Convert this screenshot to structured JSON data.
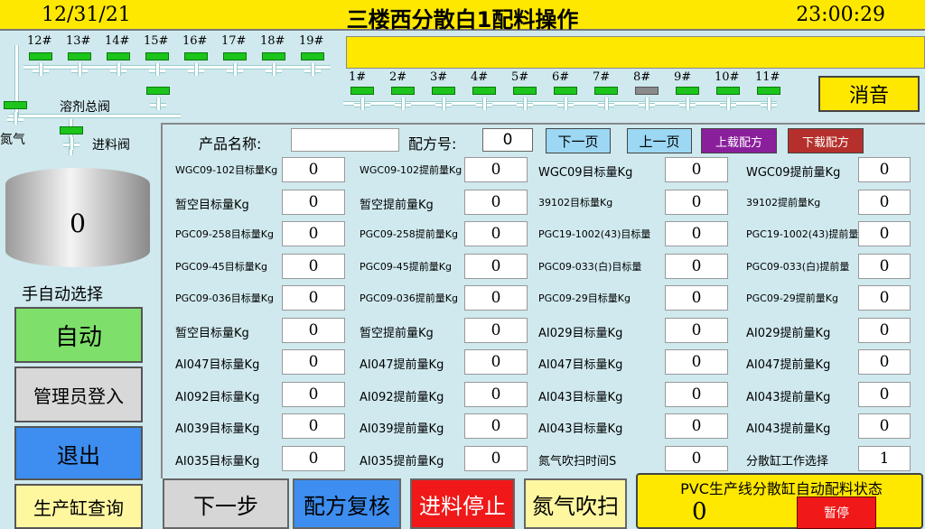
{
  "header": {
    "date": "12/31/21",
    "title": "三楼西分散白1配料操作",
    "time": "23:00:29"
  },
  "solvent_valves": {
    "labels": [
      "12#",
      "13#",
      "14#",
      "15#",
      "16#",
      "17#",
      "18#",
      "19#"
    ],
    "states": [
      "on",
      "on",
      "on",
      "on",
      "on",
      "on",
      "on",
      "on"
    ]
  },
  "solvent_label": "溶剂总阀",
  "nitrogen_label": "氮气",
  "feed_valve_label": "进料阀",
  "feed_valves": {
    "labels": [
      "1#",
      "2#",
      "3#",
      "4#",
      "5#",
      "6#",
      "7#",
      "8#",
      "9#",
      "10#",
      "11#"
    ],
    "states": [
      "on",
      "on",
      "on",
      "on",
      "on",
      "on",
      "on",
      "off",
      "on",
      "on",
      "on"
    ]
  },
  "mute_button": "消音",
  "tank": {
    "value": "0"
  },
  "left_panel": {
    "mode_title": "手自动选择",
    "auto_button": "自动",
    "admin_button": "管理员登入",
    "exit_button": "退出",
    "query_button": "生产缸查询"
  },
  "form": {
    "product_name_label": "产品名称:",
    "product_name_value": "",
    "recipe_no_label": "配方号:",
    "recipe_no_value": "0",
    "next_page": "下一页",
    "prev_page": "上一页",
    "upload_recipe": "上载配方",
    "download_recipe": "下载配方"
  },
  "fields": [
    [
      "WGC09-102目标量Kg",
      "0",
      "WGC09-102提前量Kg",
      "0",
      "WGC09目标量Kg",
      "0",
      "WGC09提前量Kg",
      "0"
    ],
    [
      "暂空目标量Kg",
      "0",
      "暂空提前量Kg",
      "0",
      "39102目标量Kg",
      "0",
      "39102提前量Kg",
      "0"
    ],
    [
      "PGC09-258目标量Kg",
      "0",
      "PGC09-258提前量Kg",
      "0",
      "PGC19-1002(43)目标量",
      "0",
      "PGC19-1002(43)提前量",
      "0"
    ],
    [
      "PGC09-45目标量Kg",
      "0",
      "PGC09-45提前量Kg",
      "0",
      "PGC09-033(白)目标量",
      "0",
      "PGC09-033(白)提前量",
      "0"
    ],
    [
      "PGC09-036目标量Kg",
      "0",
      "PGC09-036提前量Kg",
      "0",
      "PGC09-29目标量Kg",
      "0",
      "PGC09-29提前量Kg",
      "0"
    ],
    [
      "暂空目标量Kg",
      "0",
      "暂空提前量Kg",
      "0",
      "AI029目标量Kg",
      "0",
      "AI029提前量Kg",
      "0"
    ],
    [
      "AI047目标量Kg",
      "0",
      "AI047提前量Kg",
      "0",
      "AI047目标量Kg",
      "0",
      "AI047提前量Kg",
      "0"
    ],
    [
      "AI092目标量Kg",
      "0",
      "AI092提前量Kg",
      "0",
      "AI043目标量Kg",
      "0",
      "AI043提前量Kg",
      "0"
    ],
    [
      "AI039目标量Kg",
      "0",
      "AI039提前量Kg",
      "0",
      "AI043目标量Kg",
      "0",
      "AI043提前量Kg",
      "0"
    ],
    [
      "AI035目标量Kg",
      "0",
      "AI035提前量Kg",
      "0",
      "氮气吹扫时间S",
      "0",
      "分散缸工作选择",
      "1"
    ]
  ],
  "bottom": {
    "next_step": "下一步",
    "recipe_review": "配方复核",
    "feed_stop": "进料停止",
    "nitrogen_blow": "氮气吹扫"
  },
  "status": {
    "title": "PVC生产线分散缸自动配料状态",
    "value": "0",
    "pause": "暂停"
  },
  "colors": {
    "header": "#ffe800",
    "lamp_on": "#1cc41c",
    "lamp_off": "#8a8a8a",
    "panel_bg": "#cfe9ee"
  }
}
